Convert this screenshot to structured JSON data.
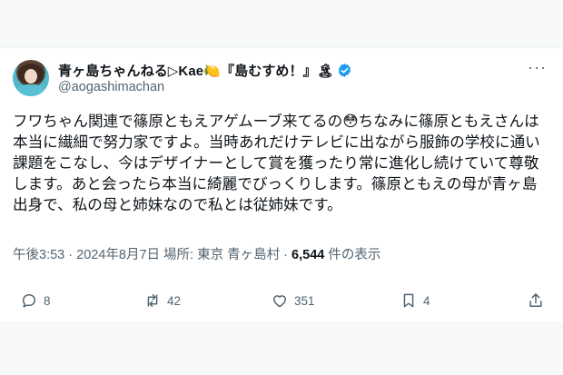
{
  "user": {
    "display_name": "青ヶ島ちゃんねる▷Kae🍋『島むすめ！』🏝",
    "handle": "@aogashimachan",
    "verified_color": "#1d9bf0"
  },
  "tweet": {
    "text": "フワちゃん関連で篠原ともえアゲムーブ来てるの😳ちなみに篠原ともえさんは本当に繊細で努力家ですよ。当時あれだけテレビに出ながら服飾の学校に通い課題をこなし、今はデザイナーとして賞を獲ったり常に進化し続けていて尊敬します。あと会ったら本当に綺麗でびっくりします。篠原ともえの母が青ヶ島出身で、私の母と姉妹なので私とは従姉妹です。",
    "time": "午後3:53",
    "date": "2024年8月7日",
    "location_label": "場所:",
    "location": "東京 青ヶ島村",
    "views": "6,544",
    "views_label": "件の表示"
  },
  "actions": {
    "replies": "8",
    "reposts": "42",
    "likes": "351",
    "bookmarks": "4"
  },
  "icons": [
    "more-icon",
    "reply-icon",
    "repost-icon",
    "like-icon",
    "bookmark-icon",
    "share-icon",
    "verified-icon"
  ]
}
